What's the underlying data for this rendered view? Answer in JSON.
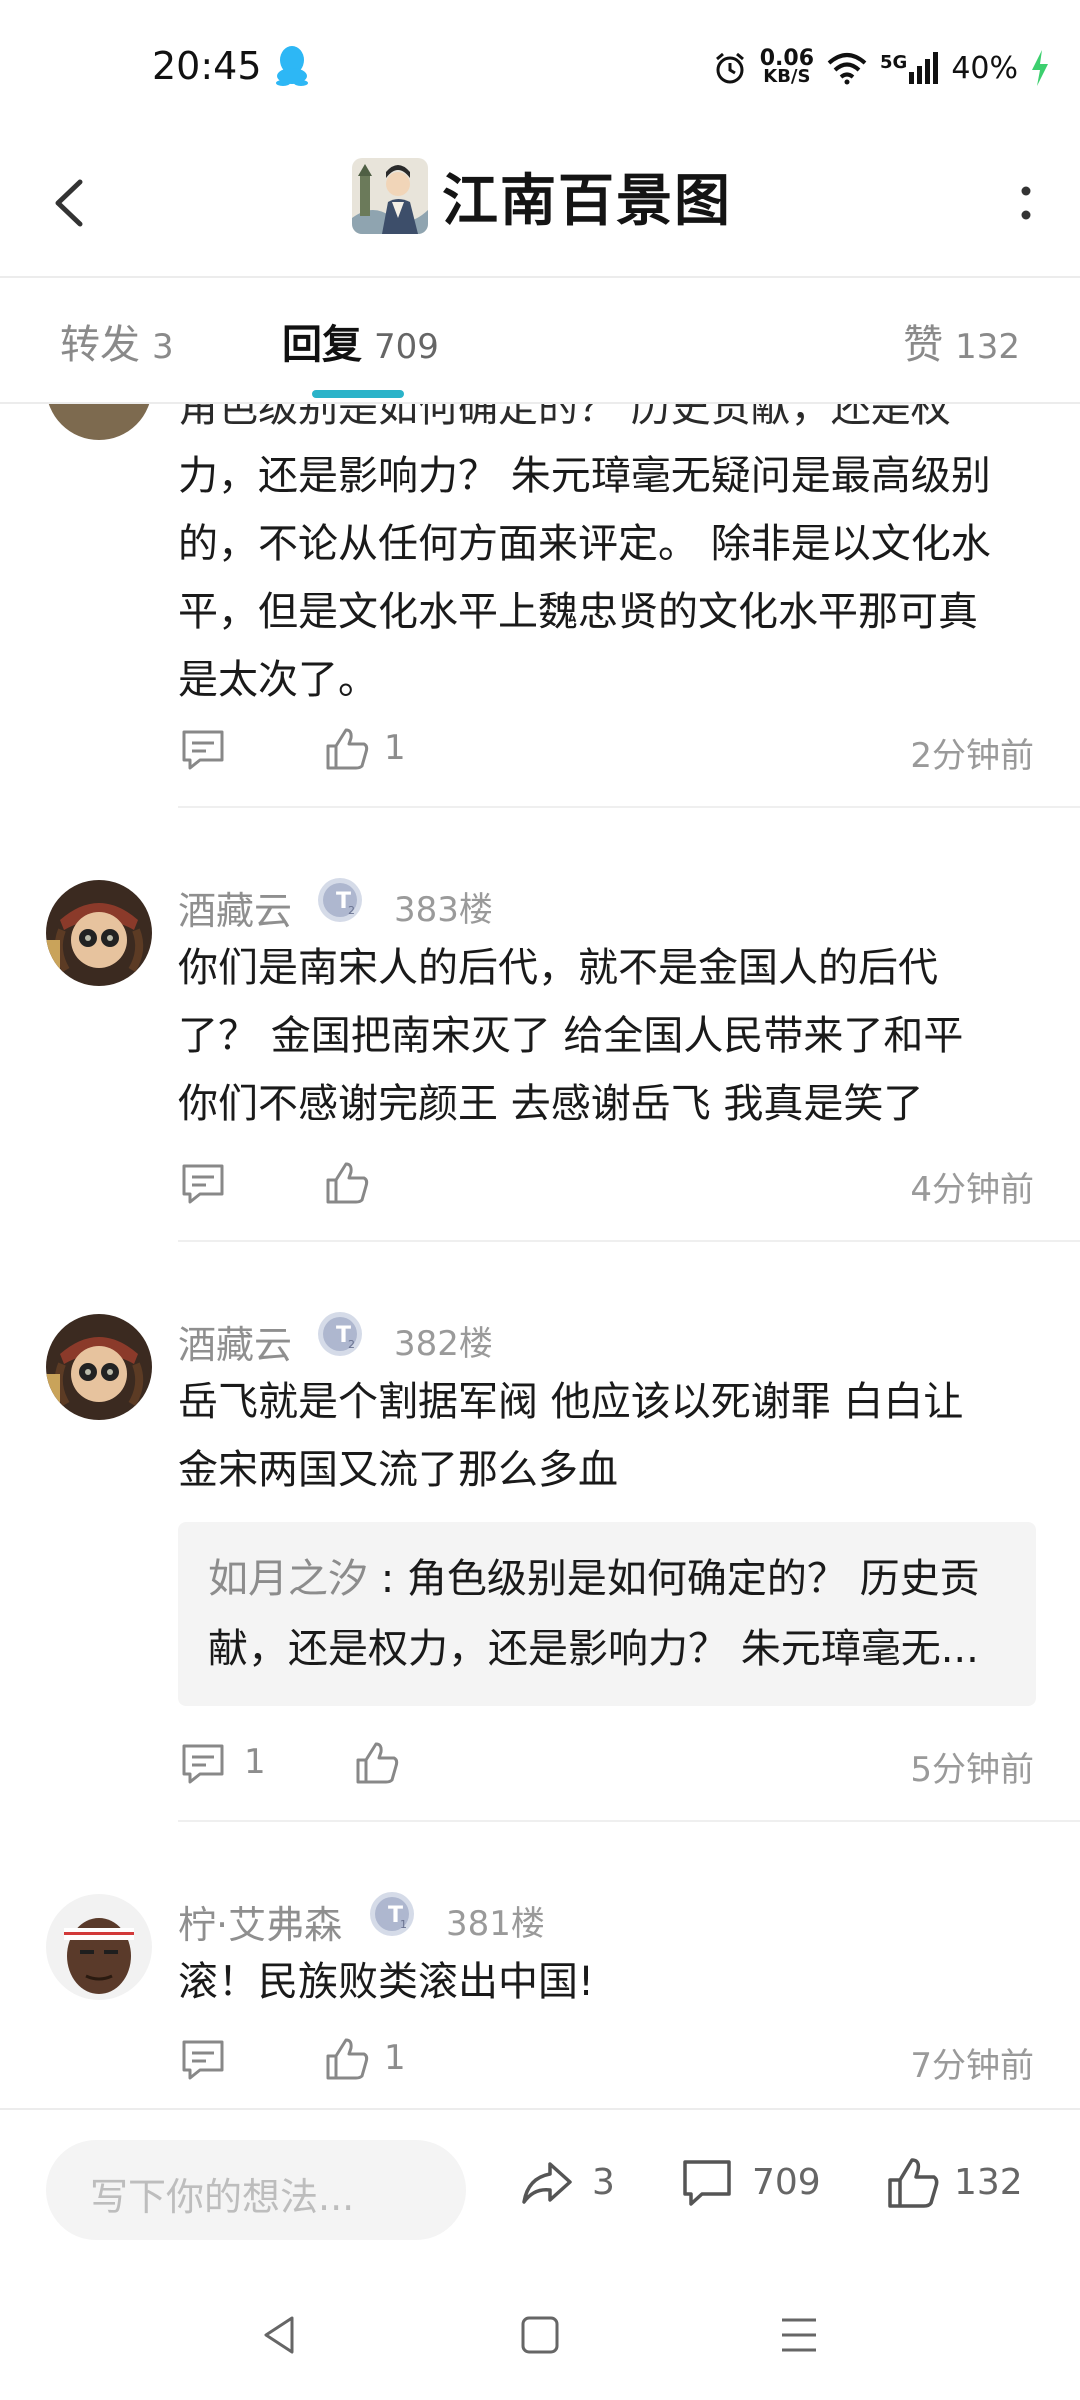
{
  "status_bar": {
    "time": "20:45",
    "net_speed_value": "0.06",
    "net_speed_unit": "KB/S",
    "network": "5G",
    "battery": "40%"
  },
  "header": {
    "title": "江南百景图",
    "icons": [
      "back-icon",
      "forum-logo",
      "more-icon"
    ]
  },
  "tabs": [
    {
      "label": "转发",
      "count": "3"
    },
    {
      "label": "回复",
      "count": "709"
    },
    {
      "label": "赞",
      "count": "132"
    }
  ],
  "comments": [
    {
      "partial_first_line": "角色级别是如何确定的？ 历史贡献，还是权",
      "text_lines": [
        "力，还是影响力？ 朱元璋毫无疑问是最高级别",
        "的，不论从任何方面来评定。 除非是以文化水",
        "平，但是文化水平上魏忠贤的文化水平那可真",
        "是太次了。"
      ],
      "likes": "1",
      "time": "2分钟前"
    },
    {
      "username": "酒藏云",
      "badge": "T2",
      "floor": "383楼",
      "text_lines": [
        "你们是南宋人的后代，就不是金国人的后代",
        "了？ 金国把南宋灭了 给全国人民带来了和平",
        "你们不感谢完颜王 去感谢岳飞 我真是笑了"
      ],
      "time": "4分钟前"
    },
    {
      "username": "酒藏云",
      "badge": "T2",
      "floor": "382楼",
      "text_lines": [
        "岳飞就是个割据军阀 他应该以死谢罪  白白让",
        "金宋两国又流了那么多血"
      ],
      "quote": {
        "author": "如月之汐",
        "line1": "角色级别是如何确定的？ 历史贡",
        "line2": "献，还是权力，还是影响力？ 朱元璋毫无..."
      },
      "replies": "1",
      "time": "5分钟前"
    },
    {
      "username": "柠·艾弗森",
      "badge": "T1",
      "floor": "381楼",
      "text_lines": [
        "滚！民族败类滚出中国!"
      ],
      "likes": "1",
      "time": "7分钟前"
    }
  ],
  "bottom_bar": {
    "placeholder": "写下你的想法...",
    "forwards": "3",
    "comments": "709",
    "likes": "132"
  },
  "nav_bar": {
    "icons": [
      "nav-back-icon",
      "nav-home-icon",
      "nav-menu-icon"
    ]
  },
  "colors": {
    "accent": "#2ab3c9",
    "muted_text": "#8f8f8f",
    "divider": "#ececec",
    "quote_bg": "#f4f4f4"
  }
}
